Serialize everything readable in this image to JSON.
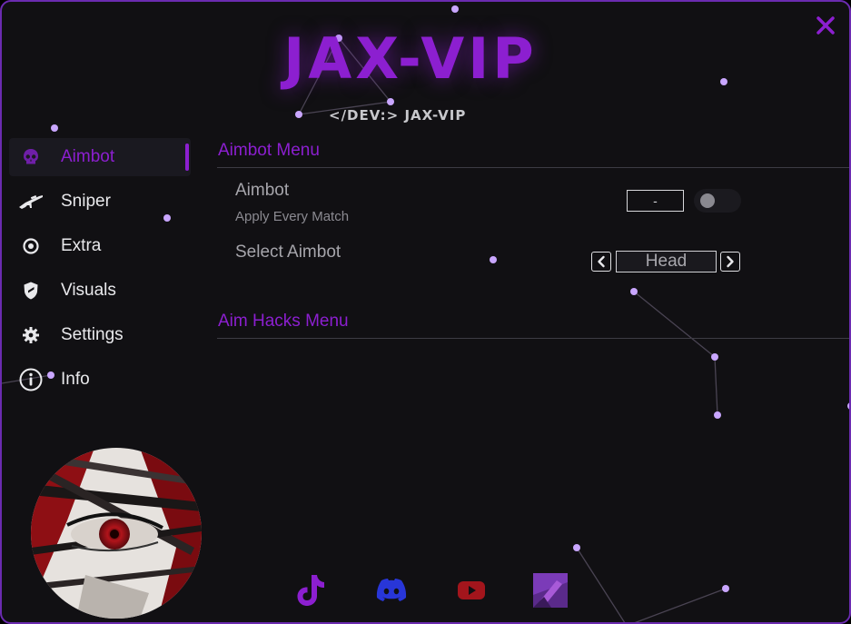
{
  "app": {
    "logo_text": "JAX-VIP",
    "subtitle": "</DEV:> JAX-VIP",
    "close_glyph": "✕"
  },
  "colors": {
    "accent": "#8c1fd0",
    "background": "#111013",
    "border": "#6b2bb0",
    "text": "#e9e9ec",
    "muted": "#a6a5ab"
  },
  "sidebar": {
    "items": [
      {
        "label": "Aimbot",
        "icon": "skull-icon",
        "active": true
      },
      {
        "label": "Sniper",
        "icon": "rifle-icon",
        "active": false
      },
      {
        "label": "Extra",
        "icon": "target-icon",
        "active": false
      },
      {
        "label": "Visuals",
        "icon": "shield-icon",
        "active": false
      },
      {
        "label": "Settings",
        "icon": "gear-icon",
        "active": false
      },
      {
        "label": "Info",
        "icon": "info-icon",
        "active": false
      }
    ]
  },
  "main": {
    "section1_title": "Aimbot Menu",
    "aimbot_label": "Aimbot",
    "aimbot_sub": "Apply Every Match",
    "keybind_value": "-",
    "toggle_on": false,
    "select_label": "Select Aimbot",
    "select_value": "Head",
    "section2_title": "Aim Hacks Menu"
  },
  "footer": {
    "socials": [
      "tiktok-icon",
      "discord-icon",
      "youtube-icon",
      "profile-thumbnail-icon"
    ]
  }
}
